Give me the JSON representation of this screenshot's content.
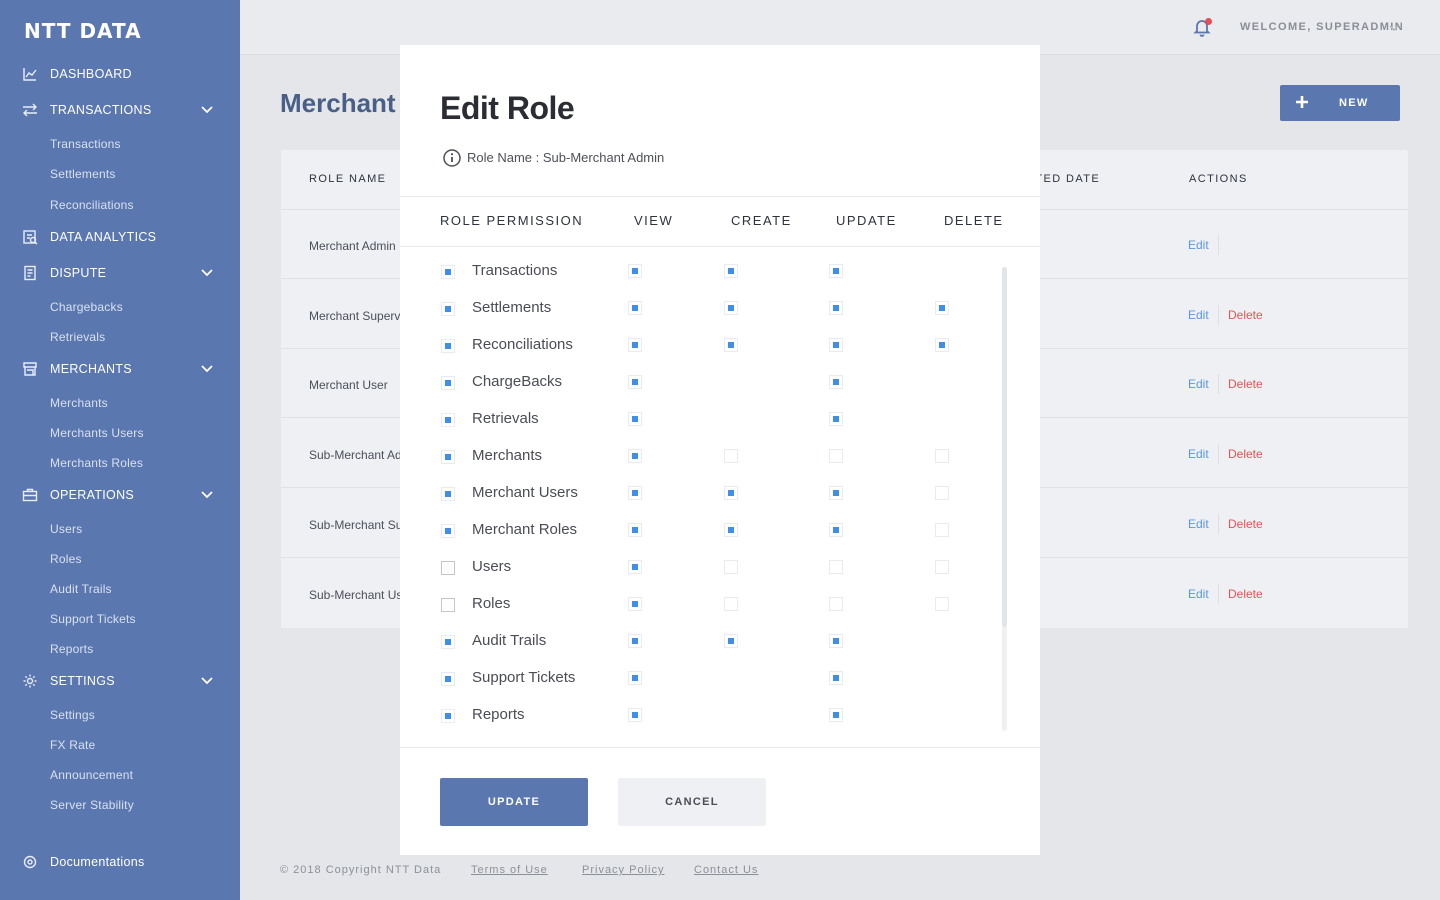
{
  "brand": {
    "logo_text": "NTT DATA",
    "accent": "#5b77b0"
  },
  "sidebar": {
    "dashboard": "DASHBOARD",
    "transactions": {
      "label": "TRANSACTIONS",
      "items": [
        "Transactions",
        "Settlements",
        "Reconciliations"
      ]
    },
    "data_analytics": "DATA ANALYTICS",
    "dispute": {
      "label": "DISPUTE",
      "items": [
        "Chargebacks",
        "Retrievals"
      ]
    },
    "merchants": {
      "label": "MERCHANTS",
      "items": [
        "Merchants",
        "Merchants Users",
        "Merchants Roles"
      ]
    },
    "operations": {
      "label": "OPERATIONS",
      "items": [
        "Users",
        "Roles",
        "Audit Trails",
        "Support Tickets",
        "Reports"
      ]
    },
    "settings": {
      "label": "SETTINGS",
      "items": [
        "Settings",
        "FX Rate",
        "Announcement",
        "Server Stability"
      ]
    },
    "documentations": "Documentations"
  },
  "header": {
    "welcome": "WELCOME, SUPERADMIN"
  },
  "page": {
    "title": "Merchant Roles",
    "new_button": "NEW",
    "columns": {
      "role_name": "ROLE NAME",
      "created_date": "CREATED DATE",
      "actions": "ACTIONS"
    },
    "rows": [
      {
        "name": "Merchant Admin",
        "edit": "Edit",
        "delete": ""
      },
      {
        "name": "Merchant Supervisor",
        "edit": "Edit",
        "delete": "Delete"
      },
      {
        "name": "Merchant User",
        "edit": "Edit",
        "delete": "Delete"
      },
      {
        "name": "Sub-Merchant Admin",
        "edit": "Edit",
        "delete": "Delete"
      },
      {
        "name": "Sub-Merchant Supervisor",
        "edit": "Edit",
        "delete": "Delete"
      },
      {
        "name": "Sub-Merchant User",
        "edit": "Edit",
        "delete": "Delete"
      }
    ]
  },
  "footer": {
    "copyright": "© 2018 Copyright NTT Data",
    "terms": "Terms of Use",
    "privacy": "Privacy Policy",
    "contact": "Contact Us"
  },
  "modal": {
    "title": "Edit Role",
    "role_name_label": "Role Name : Sub-Merchant Admin",
    "headers": {
      "permission": "ROLE PERMISSION",
      "view": "VIEW",
      "create": "CREATE",
      "update": "UPDATE",
      "delete": "DELETE"
    },
    "permissions": [
      {
        "name": "Transactions",
        "row": "on",
        "view": "on",
        "create": "on",
        "update": "on",
        "delete": "none"
      },
      {
        "name": "Settlements",
        "row": "on",
        "view": "on",
        "create": "on",
        "update": "on",
        "delete": "on"
      },
      {
        "name": "Reconciliations",
        "row": "on",
        "view": "on",
        "create": "on",
        "update": "on",
        "delete": "on"
      },
      {
        "name": "ChargeBacks",
        "row": "on",
        "view": "on",
        "create": "none",
        "update": "on",
        "delete": "none"
      },
      {
        "name": "Retrievals",
        "row": "on",
        "view": "on",
        "create": "none",
        "update": "on",
        "delete": "none"
      },
      {
        "name": "Merchants",
        "row": "on",
        "view": "on",
        "create": "off",
        "update": "off",
        "delete": "off"
      },
      {
        "name": "Merchant Users",
        "row": "on",
        "view": "on",
        "create": "on",
        "update": "on",
        "delete": "off"
      },
      {
        "name": "Merchant Roles",
        "row": "on",
        "view": "on",
        "create": "on",
        "update": "on",
        "delete": "off"
      },
      {
        "name": "Users",
        "row": "off",
        "view": "on",
        "create": "off",
        "update": "off",
        "delete": "off"
      },
      {
        "name": "Roles",
        "row": "off",
        "view": "on",
        "create": "off",
        "update": "off",
        "delete": "off"
      },
      {
        "name": "Audit Trails",
        "row": "on",
        "view": "on",
        "create": "on",
        "update": "on",
        "delete": "none"
      },
      {
        "name": "Support Tickets",
        "row": "on",
        "view": "on",
        "create": "none",
        "update": "on",
        "delete": "none"
      },
      {
        "name": "Reports",
        "row": "on",
        "view": "on",
        "create": "none",
        "update": "on",
        "delete": "none"
      }
    ],
    "update_button": "UPDATE",
    "cancel_button": "CANCEL"
  }
}
